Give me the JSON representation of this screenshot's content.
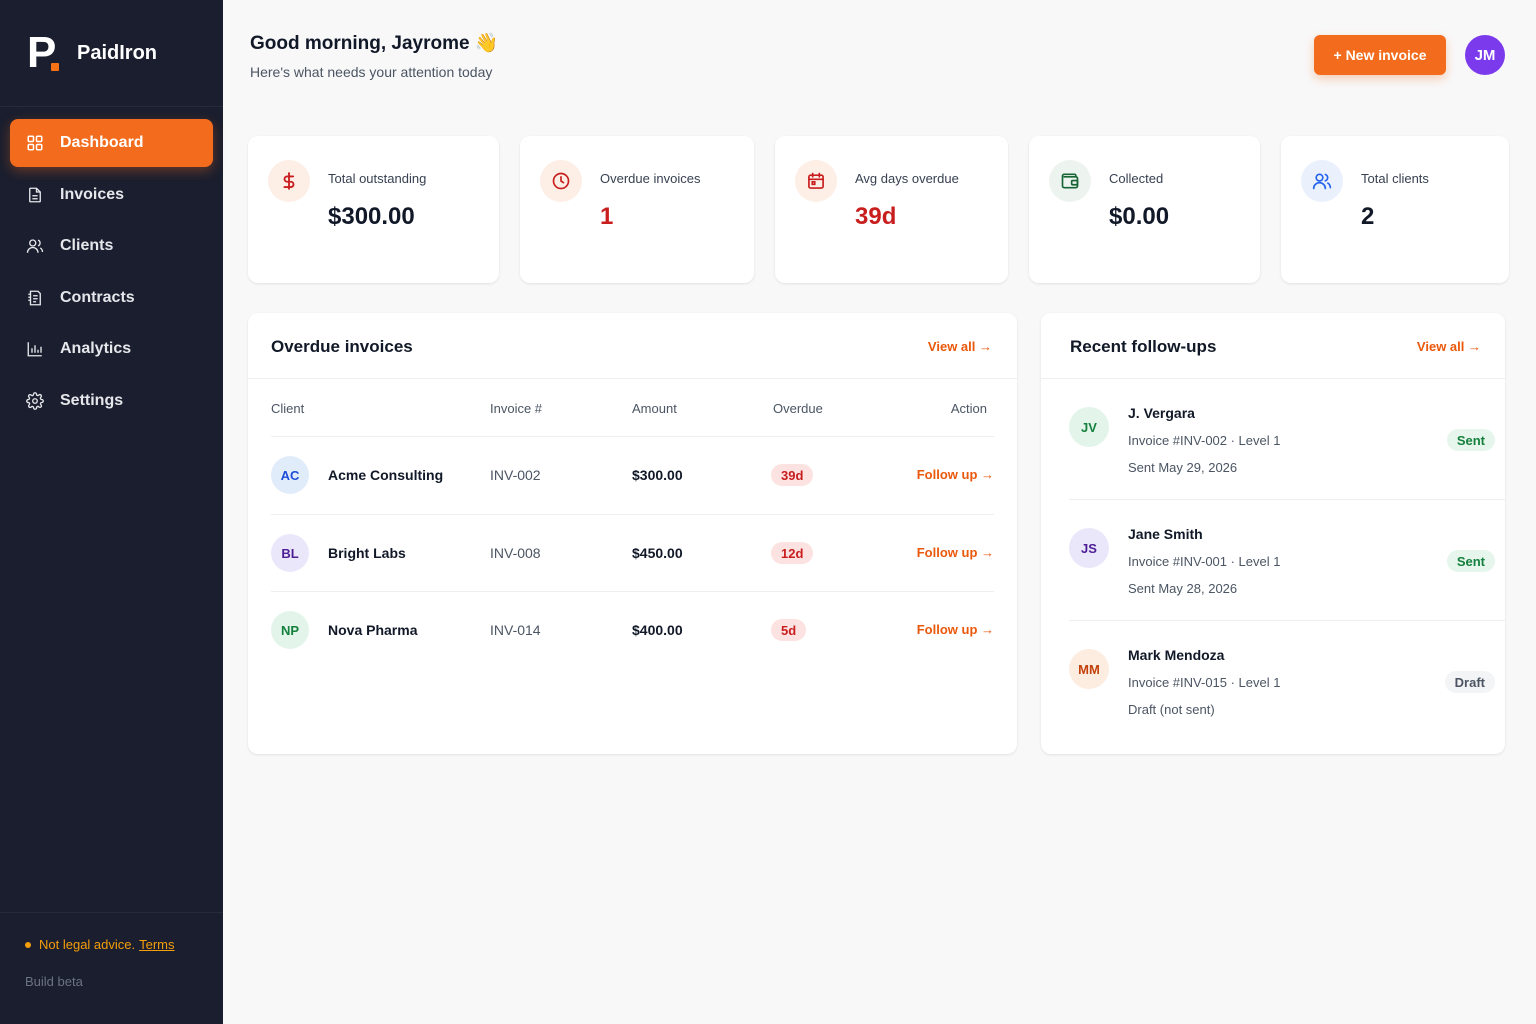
{
  "brand": {
    "letter": "P",
    "name": "PaidIron",
    "accent": "#f97316"
  },
  "nav": [
    {
      "label": "Dashboard",
      "icon": "grid-icon",
      "active": true
    },
    {
      "label": "Invoices",
      "icon": "document-icon"
    },
    {
      "label": "Clients",
      "icon": "users-icon"
    },
    {
      "label": "Contracts",
      "icon": "contract-icon"
    },
    {
      "label": "Analytics",
      "icon": "bar-chart-icon"
    },
    {
      "label": "Settings",
      "icon": "gear-icon"
    }
  ],
  "footer": {
    "legal_text": "Not legal advice.",
    "terms_label": "Terms",
    "build_label": "Build beta"
  },
  "header": {
    "greeting": "Good morning, Jayrome 👋",
    "subtitle": "Here's what needs your attention today",
    "new_invoice_label": "+ New invoice",
    "avatar_initials": "JM"
  },
  "stats": [
    {
      "label": "Total outstanding",
      "value": "$300.00",
      "icon": "dollar-icon"
    },
    {
      "label": "Overdue invoices",
      "value": "1",
      "icon": "clock-icon"
    },
    {
      "label": "Avg days overdue",
      "value": "39d",
      "icon": "calendar-icon"
    },
    {
      "label": "Collected",
      "value": "$0.00",
      "icon": "wallet-icon"
    },
    {
      "label": "Total clients",
      "value": "2",
      "icon": "users-icon"
    }
  ],
  "overdue": {
    "title": "Overdue invoices",
    "view_all": "View all →",
    "columns": [
      "Client",
      "Invoice #",
      "Amount",
      "Overdue",
      "Action"
    ],
    "rows": [
      {
        "initials": "AC",
        "client": "Acme Consulting",
        "invoice": "INV-002",
        "amount": "$300.00",
        "overdue": "39d",
        "action": "Follow up →"
      },
      {
        "initials": "BL",
        "client": "Bright Labs",
        "invoice": "INV-008",
        "amount": "$450.00",
        "overdue": "12d",
        "action": "Follow up →"
      },
      {
        "initials": "NP",
        "client": "Nova Pharma",
        "invoice": "INV-014",
        "amount": "$400.00",
        "overdue": "5d",
        "action": "Follow up →"
      }
    ]
  },
  "followups": {
    "title": "Recent follow-ups",
    "view_all": "View all →",
    "items": [
      {
        "initials": "JV",
        "name": "J. Vergara",
        "meta": "Invoice #INV-002 · Level 1",
        "date": "Sent May 29, 2026",
        "status": "Sent"
      },
      {
        "initials": "JS",
        "name": "Jane Smith",
        "meta": "Invoice #INV-001 · Level 1",
        "date": "Sent May 28, 2026",
        "status": "Sent"
      },
      {
        "initials": "MM",
        "name": "Mark Mendoza",
        "meta": "Invoice #INV-015 · Level 1",
        "date": "Draft (not sent)",
        "status": "Draft"
      }
    ]
  }
}
